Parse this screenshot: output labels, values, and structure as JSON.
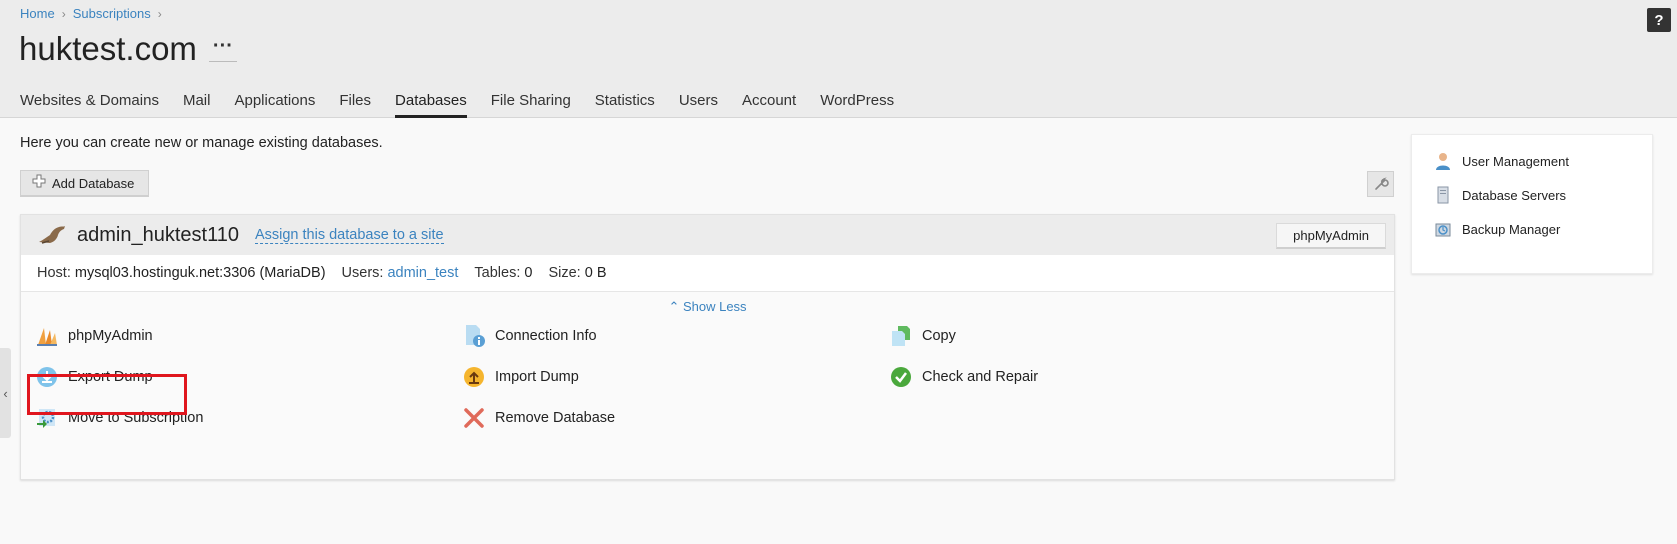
{
  "breadcrumb": {
    "home": "Home",
    "subscriptions": "Subscriptions"
  },
  "page": {
    "title": "huktest.com",
    "more": "···",
    "help": "?"
  },
  "tabs": [
    {
      "label": "Websites & Domains"
    },
    {
      "label": "Mail"
    },
    {
      "label": "Applications"
    },
    {
      "label": "Files"
    },
    {
      "label": "Databases",
      "active": true
    },
    {
      "label": "File Sharing"
    },
    {
      "label": "Statistics"
    },
    {
      "label": "Users"
    },
    {
      "label": "Account"
    },
    {
      "label": "WordPress"
    }
  ],
  "main": {
    "intro": "Here you can create new or manage existing databases.",
    "add_database": "Add Database"
  },
  "database": {
    "name": "admin_huktest110",
    "assign_link": "Assign this database to a site",
    "phpmyadmin_button": "phpMyAdmin",
    "host_label": "Host:",
    "host_value": "mysql03.hostinguk.net:3306 (MariaDB)",
    "users_label": "Users:",
    "users_value": "admin_test",
    "tables_label": "Tables:",
    "tables_value": "0",
    "size_label": "Size:",
    "size_value": "0 B",
    "show_less": "Show Less",
    "actions": {
      "phpmyadmin": "phpMyAdmin",
      "connection_info": "Connection Info",
      "copy": "Copy",
      "export_dump": "Export Dump",
      "import_dump": "Import Dump",
      "check_repair": "Check and Repair",
      "move_subscription": "Move to Subscription",
      "remove_database": "Remove Database"
    }
  },
  "right_panel": {
    "user_management": "User Management",
    "database_servers": "Database Servers",
    "backup_manager": "Backup Manager"
  },
  "colors": {
    "link": "#3b83bf",
    "highlight": "#e0161e"
  }
}
